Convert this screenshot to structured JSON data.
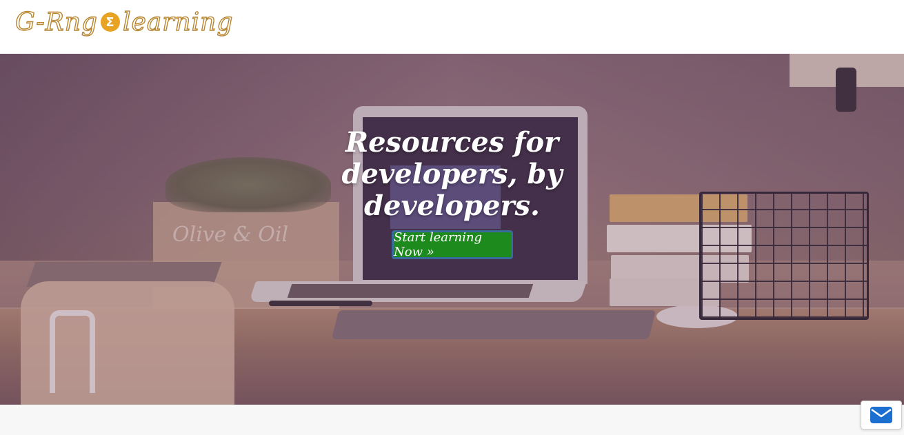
{
  "brand": {
    "logo_left": "G-Rng",
    "logo_symbol": "Σ",
    "logo_right": "learning",
    "logo_color": "#b8862f",
    "symbol_color": "#e8a324"
  },
  "hero": {
    "heading": "Resources for developers, by developers.",
    "cta_label": "Start learning Now »",
    "cta_color": "#1d8a1d",
    "background_description_icon": "desk-workspace-photo",
    "box_text": "Olive & Oil"
  },
  "contact": {
    "icon": "envelope-icon",
    "icon_color": "#1a6fd1"
  }
}
